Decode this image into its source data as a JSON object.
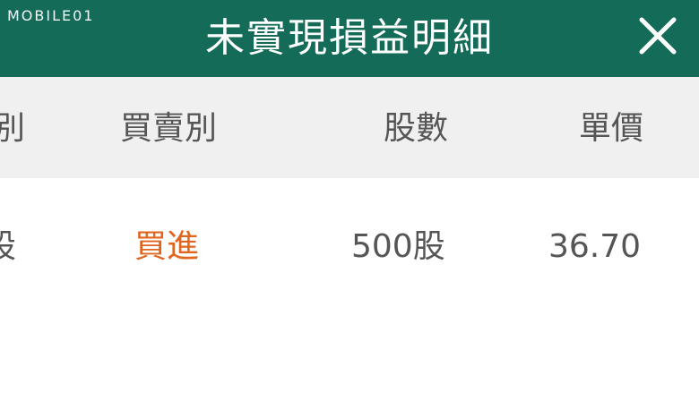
{
  "watermark": "MOBILE01",
  "header": {
    "title": "未實現損益明細",
    "close_icon": "close-icon"
  },
  "columns": {
    "col0_partial": "別",
    "buy_sell": "買賣別",
    "shares": "股數",
    "price": "單價"
  },
  "row": {
    "col0_partial": "股",
    "buy_sell": "買進",
    "shares": "500股",
    "price": "36.70"
  },
  "colors": {
    "header_bg": "#136b58",
    "buy_text": "#e0661f"
  }
}
